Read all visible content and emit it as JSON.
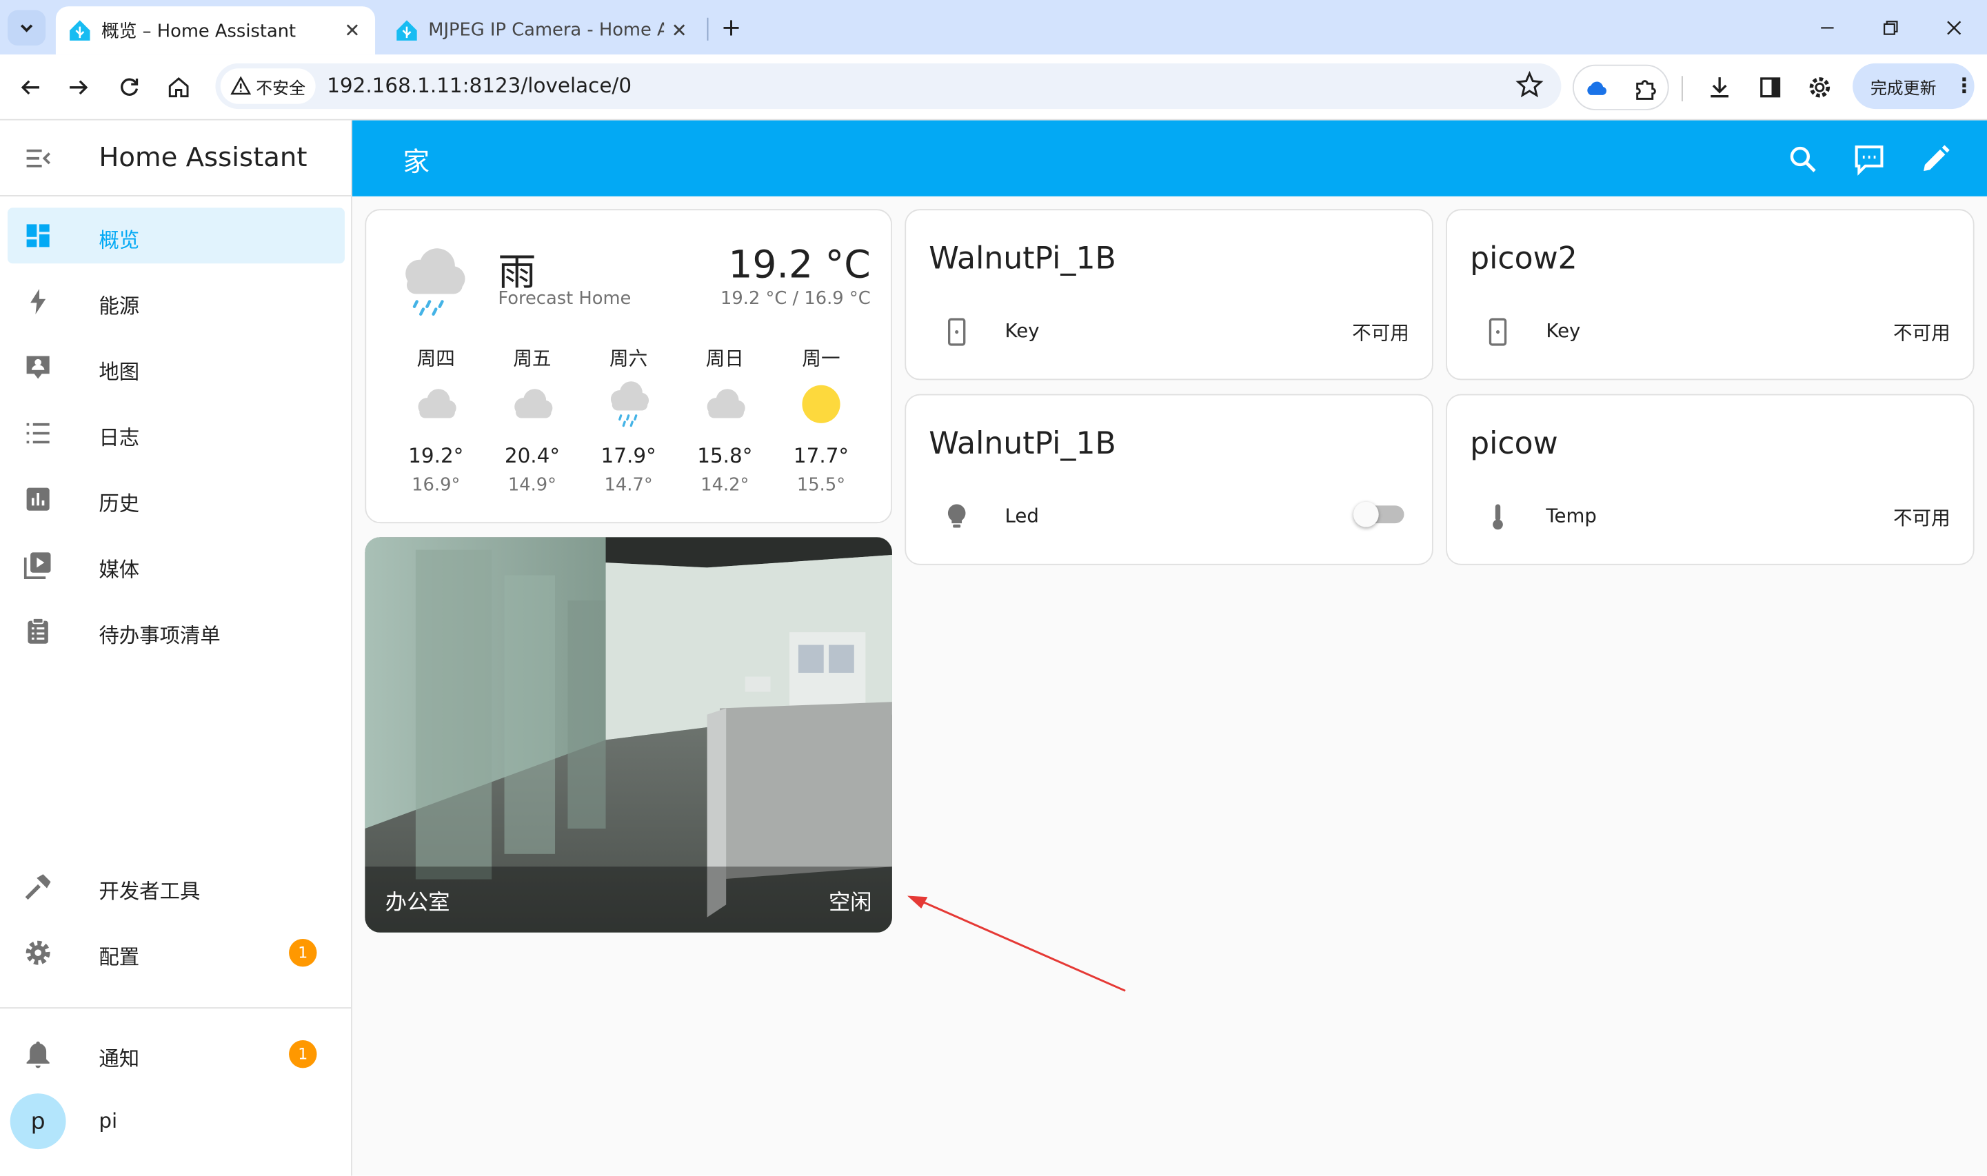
{
  "browser": {
    "tabs": [
      {
        "title": "概览 – Home Assistant",
        "active": true
      },
      {
        "title": "MJPEG IP Camera - Home Assistant",
        "active": false
      }
    ],
    "security_label": "不安全",
    "url": "192.168.1.11:8123/lovelace/0",
    "update_button": "完成更新",
    "accent_color": "#d3e3fd"
  },
  "sidebar": {
    "title": "Home Assistant",
    "items": [
      {
        "label": "概览",
        "icon": "dashboard-icon",
        "active": true
      },
      {
        "label": "能源",
        "icon": "lightning-icon"
      },
      {
        "label": "地图",
        "icon": "map-account-icon"
      },
      {
        "label": "日志",
        "icon": "list-icon"
      },
      {
        "label": "历史",
        "icon": "chart-box-icon"
      },
      {
        "label": "媒体",
        "icon": "play-box-icon"
      },
      {
        "label": "待办事项清单",
        "icon": "clipboard-list-icon"
      }
    ],
    "bottom_items": [
      {
        "label": "开发者工具",
        "icon": "hammer-icon"
      },
      {
        "label": "配置",
        "icon": "cog-icon",
        "badge": "1"
      }
    ],
    "notifications": {
      "label": "通知",
      "badge": "1"
    },
    "user": {
      "initial": "p",
      "name": "pi"
    }
  },
  "header": {
    "title": "家",
    "color": "#03a9f4"
  },
  "weather": {
    "condition": "雨",
    "name": "Forecast Home",
    "temperature": "19.2 °C",
    "range": "19.2 °C / 16.9 °C",
    "forecast": [
      {
        "day": "周四",
        "icon": "cloudy-icon",
        "high": "19.2°",
        "low": "16.9°"
      },
      {
        "day": "周五",
        "icon": "cloudy-icon",
        "high": "20.4°",
        "low": "14.9°"
      },
      {
        "day": "周六",
        "icon": "rainy-icon",
        "high": "17.9°",
        "low": "14.7°"
      },
      {
        "day": "周日",
        "icon": "cloudy-icon",
        "high": "15.8°",
        "low": "14.2°"
      },
      {
        "day": "周一",
        "icon": "sunny-icon",
        "high": "17.7°",
        "low": "15.5°"
      }
    ]
  },
  "cards": [
    {
      "title": "WalnutPi_1B",
      "entity": "Key",
      "state": "不可用",
      "icon": "door-sensor-icon"
    },
    {
      "title": "picow2",
      "entity": "Key",
      "state": "不可用",
      "icon": "door-sensor-icon"
    },
    {
      "title": "WalnutPi_1B",
      "entity": "Led",
      "state": "off",
      "icon": "lightbulb-icon"
    },
    {
      "title": "picow",
      "entity": "Temp",
      "state": "不可用",
      "icon": "thermometer-icon"
    }
  ],
  "camera": {
    "name": "办公室",
    "state": "空闲"
  }
}
